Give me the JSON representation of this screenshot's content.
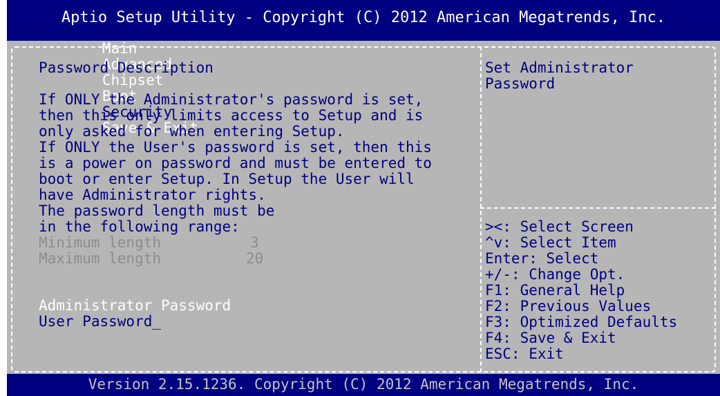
{
  "header": {
    "title": "Aptio Setup Utility - Copyright (C) 2012 American Megatrends, Inc.",
    "tabs": [
      "Main",
      "Advanced",
      "Chipset",
      "Boot",
      "Security",
      "Save & Exit"
    ],
    "active_tab": "Security"
  },
  "left_panel": {
    "heading": "Password Description",
    "description": [
      "If ONLY the Administrator's password is set,",
      "then this only limits access to Setup and is",
      "only asked for when entering Setup.",
      "If ONLY the User's password is set, then this",
      "is a power on password and must be entered to",
      "boot or enter Setup. In Setup the User will",
      "have Administrator rights.",
      "The password length must be",
      "in the following range:"
    ],
    "min_label": "Minimum length",
    "min_value": "3",
    "max_label": "Maximum length",
    "max_value": "20",
    "admin_password_label": "Administrator Password",
    "user_password_label": "User Password",
    "cursor": "_"
  },
  "help_panel": {
    "lines": [
      "Set Administrator",
      "Password"
    ]
  },
  "keys_panel": {
    "lines": [
      "><: Select Screen",
      "^v: Select Item",
      "Enter: Select",
      "+/-: Change Opt.",
      "F1: General Help",
      "F2: Previous Values",
      "F3: Optimized Defaults",
      "F4: Save & Exit",
      "ESC: Exit"
    ]
  },
  "footer": {
    "text": "Version 2.15.1236. Copyright (C) 2012 American Megatrends, Inc."
  },
  "colors": {
    "background": "#b6b6b6",
    "header_bar": "#000080",
    "text": "#000080",
    "highlight": "#ffffff",
    "disabled": "#8c8c8c"
  }
}
